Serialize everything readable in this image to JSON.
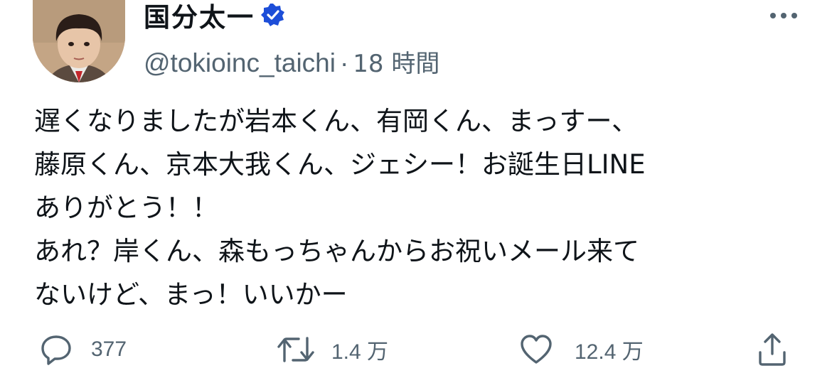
{
  "author": {
    "display_name": "国分太一",
    "handle": "@tokioinc_taichi",
    "separator": "·",
    "time_ago": "18 時間",
    "avatar_icon": "avatar-photo",
    "verified_icon": "verified-badge-icon"
  },
  "tweet": {
    "lines": [
      "遅くなりましたが岩本くん、有岡くん、まっすー、",
      "藤原くん、京本大我くん、ジェシー！お誕生日LINE",
      "ありがとう！！",
      "あれ？岸くん、森もっちゃんからお祝いメール来て",
      "ないけど、まっ！いいかー"
    ]
  },
  "actions": {
    "reply": {
      "icon": "reply-icon",
      "count": "377"
    },
    "retweet": {
      "icon": "retweet-icon",
      "count": "1.4 万"
    },
    "like": {
      "icon": "like-heart-icon",
      "count": "12.4 万"
    },
    "share": {
      "icon": "share-icon"
    }
  },
  "menu": {
    "icon": "more-options-icon"
  },
  "colors": {
    "text": "#0f1419",
    "secondary_text": "#536471",
    "verified_blue": "#1d4ed8",
    "background": "#ffffff"
  }
}
